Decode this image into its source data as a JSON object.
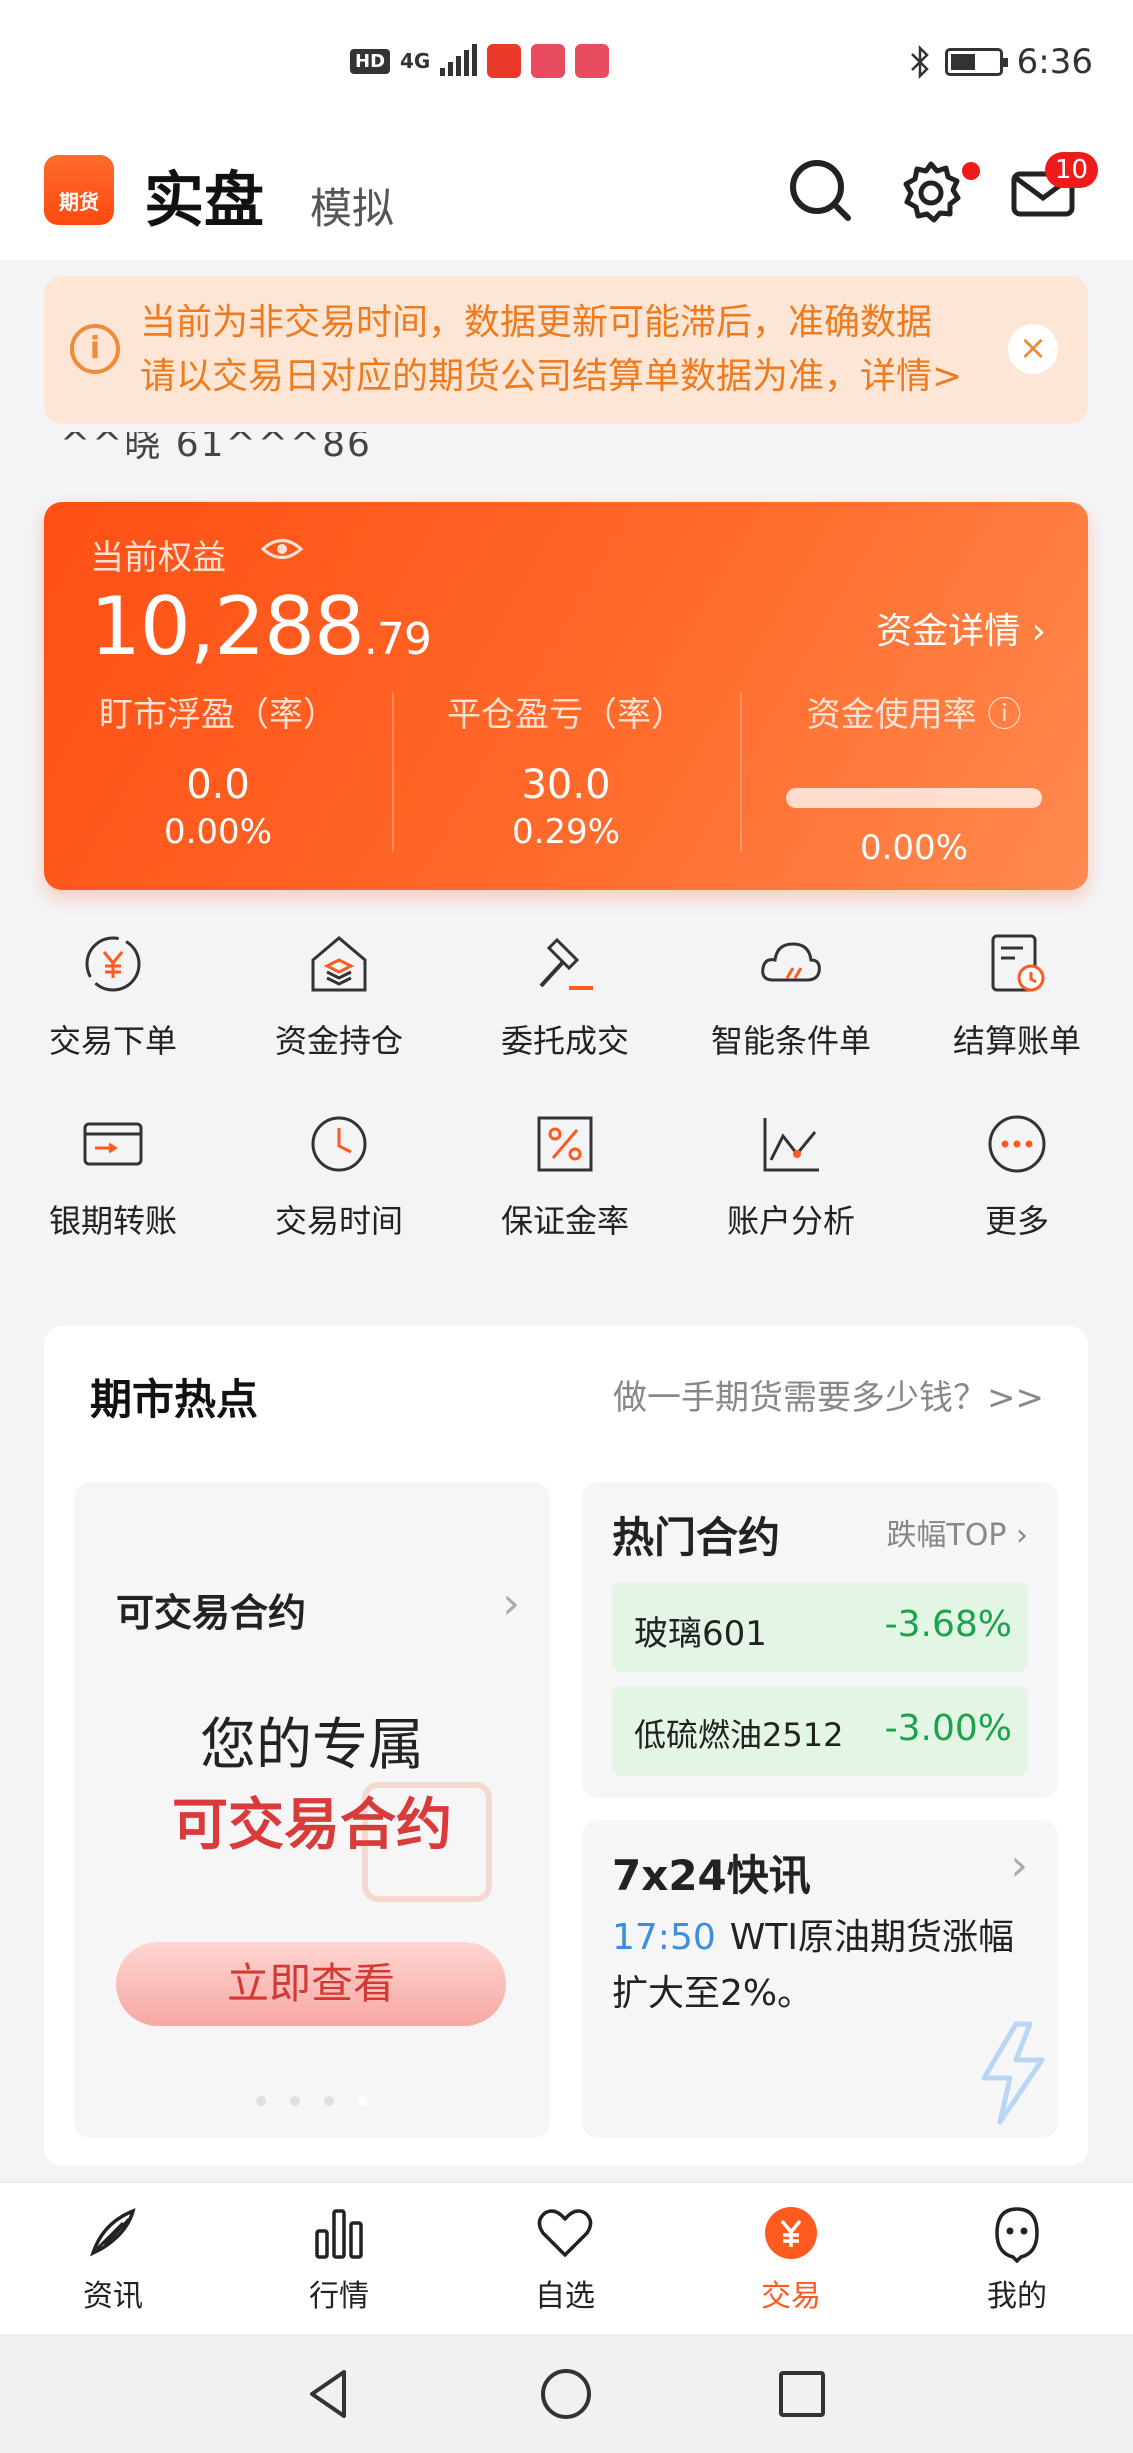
{
  "status_bar": {
    "hd": "HD",
    "net": "4G",
    "time": "6:36"
  },
  "header": {
    "logo_text": "期货",
    "title_real": "实盘",
    "title_sim": "模拟",
    "mail_count": "10"
  },
  "notice": {
    "icon": "i",
    "line1": "当前为非交易时间，数据更新可能滞后，准确数据",
    "line2": "请以交易日对应的期货公司结算单数据为准，详情>",
    "close": "×"
  },
  "account": {
    "masked": "^^晓  61^^^86"
  },
  "equity": {
    "label": "当前权益",
    "value_int": "10,288",
    "value_dec": ".79",
    "detail_link": "资金详情 ›",
    "stats": [
      {
        "label": "盯市浮盈（率）",
        "v1": "0.0",
        "v2": "0.00%"
      },
      {
        "label": "平仓盈亏（率）",
        "v1": "30.0",
        "v2": "0.29%"
      },
      {
        "label": "资金使用率 ⓘ",
        "v2": "0.00%"
      }
    ],
    "usage_ratio": 0.0
  },
  "grid": [
    {
      "label": "交易下单",
      "icon": "yuan-cycle-icon"
    },
    {
      "label": "资金持仓",
      "icon": "house-stack-icon"
    },
    {
      "label": "委托成交",
      "icon": "gavel-icon"
    },
    {
      "label": "智能条件单",
      "icon": "cloud-icon"
    },
    {
      "label": "结算账单",
      "icon": "document-clock-icon"
    },
    {
      "label": "银期转账",
      "icon": "card-transfer-icon"
    },
    {
      "label": "交易时间",
      "icon": "clock-icon"
    },
    {
      "label": "保证金率",
      "icon": "percent-icon"
    },
    {
      "label": "账户分析",
      "icon": "line-chart-icon"
    },
    {
      "label": "更多",
      "icon": "more-icon"
    }
  ],
  "hot": {
    "title": "期市热点",
    "link": "做一手期货需要多少钱？>>",
    "trade": {
      "title": "可交易合约",
      "line1": "您的专属",
      "line2": "可交易合约",
      "button": "立即查看"
    },
    "contracts": {
      "title": "热门合约",
      "top_label": "跌幅TOP ›",
      "rows": [
        {
          "name": "玻璃601",
          "pct": "-3.68%"
        },
        {
          "name": "低硫燃油2512",
          "pct": "-3.00%"
        }
      ]
    },
    "news": {
      "title": "7x24快讯",
      "time": "17:50",
      "text": "WTI原油期货涨幅扩大至2%。"
    }
  },
  "tabs": [
    {
      "label": "资讯",
      "icon": "news-feather-icon"
    },
    {
      "label": "行情",
      "icon": "bar-chart-icon"
    },
    {
      "label": "自选",
      "icon": "heart-icon"
    },
    {
      "label": "交易",
      "icon": "yuan-circle-icon"
    },
    {
      "label": "我的",
      "icon": "profile-ghost-icon"
    }
  ],
  "colors": {
    "accent": "#ff5a1f",
    "up_green": "#1aa34a",
    "notice_text": "#f07a1e"
  }
}
